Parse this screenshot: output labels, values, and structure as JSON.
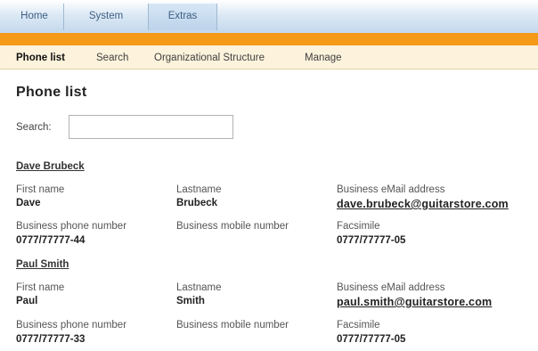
{
  "top_nav": {
    "tabs": [
      {
        "label": "Home"
      },
      {
        "label": "System"
      },
      {
        "label": "Extras"
      }
    ]
  },
  "sub_nav": {
    "items": [
      {
        "label": "Phone list"
      },
      {
        "label": "Search"
      },
      {
        "label": "Organizational Structure"
      },
      {
        "label": "Manage"
      }
    ]
  },
  "page": {
    "title": "Phone list"
  },
  "search": {
    "label": "Search:",
    "value": ""
  },
  "field_labels": {
    "first_name": "First name",
    "lastname": "Lastname",
    "email": "Business eMail address",
    "phone": "Business phone number",
    "mobile": "Business mobile number",
    "fax": "Facsimile"
  },
  "entries": [
    {
      "display_name": "Dave Brubeck",
      "first_name": "Dave",
      "lastname": "Brubeck",
      "email": "dave.brubeck@guitarstore.com",
      "phone": "0777/77777-44",
      "mobile": "",
      "fax": "0777/77777-05"
    },
    {
      "display_name": "Paul Smith",
      "first_name": "Paul",
      "lastname": "Smith",
      "email": "paul.smith@guitarstore.com",
      "phone": "0777/77777-33",
      "mobile": "",
      "fax": "0777/77777-05"
    }
  ]
}
